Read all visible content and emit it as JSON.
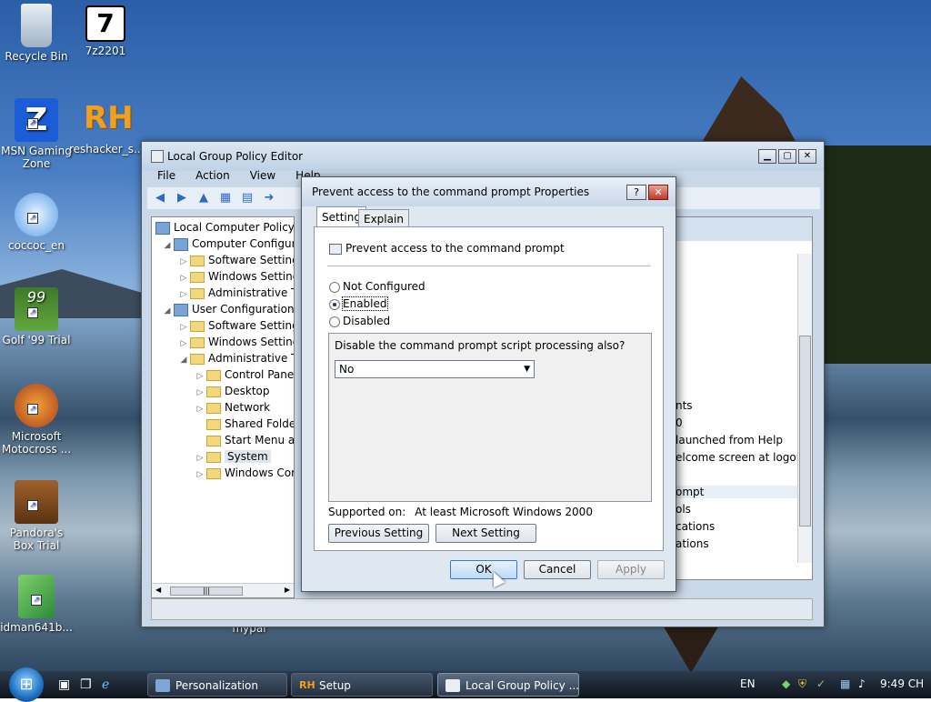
{
  "desktop": {
    "icons": [
      {
        "label": "Recycle Bin",
        "icon": "recycle-bin-icon"
      },
      {
        "label": "7z2201",
        "icon": "7zip-installer-icon"
      },
      {
        "label": "MSN Gaming Zone",
        "icon": "msn-gaming-zone-icon"
      },
      {
        "label": "reshacker_s...",
        "icon": "resource-hacker-icon"
      },
      {
        "label": "coccoc_en",
        "icon": "coccoc-installer-icon"
      },
      {
        "label": "Golf '99 Trial",
        "icon": "golf-99-icon"
      },
      {
        "label": "Microsoft Motocross ...",
        "icon": "motocross-icon"
      },
      {
        "label": "Pandora's Box Trial",
        "icon": "pandoras-box-icon"
      },
      {
        "label": "idman641b...",
        "icon": "idm-installer-icon"
      },
      {
        "label": "mypai",
        "icon": "file-icon"
      }
    ]
  },
  "gpe": {
    "title": "Local Group Policy Editor",
    "menu": [
      "File",
      "Action",
      "View",
      "Help"
    ],
    "tree": [
      {
        "label": "Local Computer Policy",
        "level": 0,
        "expander": "",
        "icon": "policy"
      },
      {
        "label": "Computer Configura",
        "level": 1,
        "expander": "open",
        "icon": "computer"
      },
      {
        "label": "Software Settings",
        "level": 2,
        "expander": "closed",
        "icon": "folder"
      },
      {
        "label": "Windows Setting",
        "level": 2,
        "expander": "closed",
        "icon": "folder"
      },
      {
        "label": "Administrative Te",
        "level": 2,
        "expander": "closed",
        "icon": "folder"
      },
      {
        "label": "User Configuration",
        "level": 1,
        "expander": "open",
        "icon": "user"
      },
      {
        "label": "Software Settings",
        "level": 2,
        "expander": "closed",
        "icon": "folder"
      },
      {
        "label": "Windows Setting",
        "level": 2,
        "expander": "closed",
        "icon": "folder"
      },
      {
        "label": "Administrative Te",
        "level": 2,
        "expander": "open",
        "icon": "folder"
      },
      {
        "label": "Control Panel",
        "level": 3,
        "expander": "closed",
        "icon": "folder"
      },
      {
        "label": "Desktop",
        "level": 3,
        "expander": "closed",
        "icon": "folder"
      },
      {
        "label": "Network",
        "level": 3,
        "expander": "closed",
        "icon": "folder"
      },
      {
        "label": "Shared Folder",
        "level": 3,
        "expander": "",
        "icon": "folder"
      },
      {
        "label": "Start Menu ar",
        "level": 3,
        "expander": "",
        "icon": "folder"
      },
      {
        "label": "System",
        "level": 3,
        "expander": "closed",
        "icon": "folder",
        "selected": true
      },
      {
        "label": "Windows Cor",
        "level": 3,
        "expander": "closed",
        "icon": "folder"
      }
    ],
    "right_items": [
      "nts",
      "0",
      "launched from Help",
      "elcome screen at logon",
      "ompt",
      "ols",
      "cations",
      "ations"
    ]
  },
  "dialog": {
    "title": "Prevent access to the command prompt Properties",
    "help_btn": "?",
    "close_btn": "✕",
    "tabs": [
      "Setting",
      "Explain"
    ],
    "setting_name": "Prevent access to the command prompt",
    "radios": [
      {
        "label": "Not Configured",
        "checked": false
      },
      {
        "label": "Enabled",
        "checked": true
      },
      {
        "label": "Disabled",
        "checked": false
      }
    ],
    "option_question": "Disable the command prompt script processing also?",
    "option_value": "No",
    "supported_label": "Supported on:",
    "supported_value": "At least Microsoft Windows 2000",
    "prev_setting": "Previous Setting",
    "next_setting": "Next Setting",
    "ok": "OK",
    "cancel": "Cancel",
    "apply": "Apply"
  },
  "taskbar": {
    "tasks": [
      {
        "label": "Personalization",
        "active": false
      },
      {
        "label": "Setup",
        "active": false
      },
      {
        "label": "Local Group Policy ...",
        "active": true
      }
    ],
    "language": "EN",
    "clock": "9:49 CH"
  },
  "colors": {
    "accent": "#3b78c6",
    "taskbar": "#1a2431",
    "close": "#c0392b"
  }
}
